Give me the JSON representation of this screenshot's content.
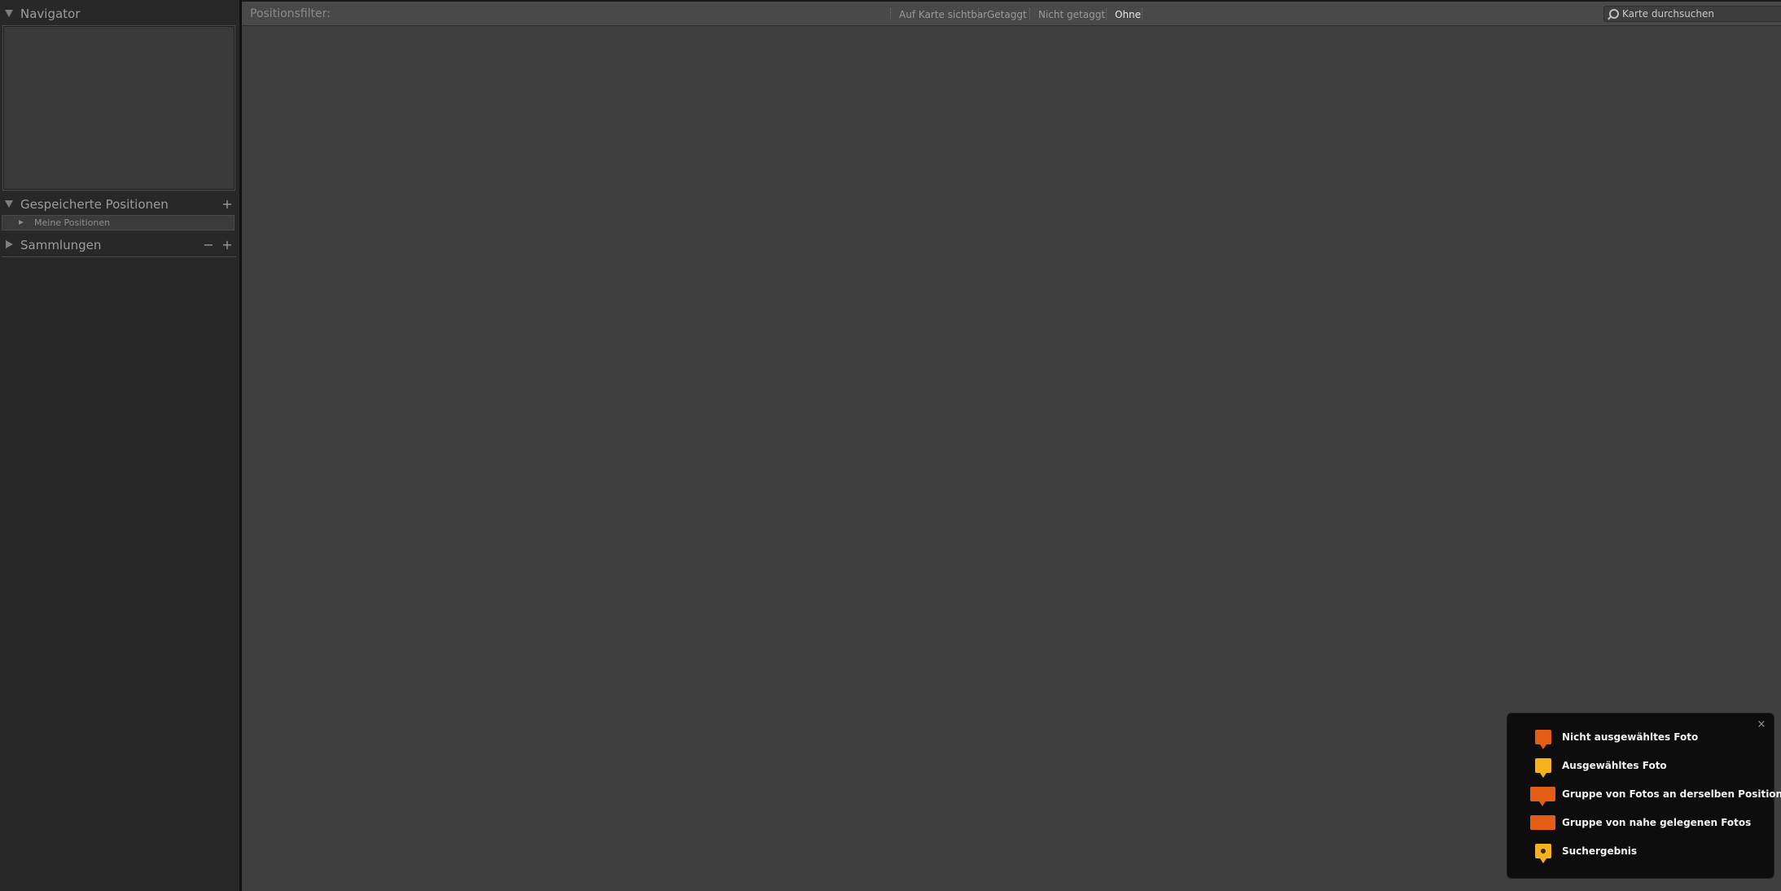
{
  "left_panel": {
    "navigator": {
      "title": "Navigator"
    },
    "saved_positions": {
      "title": "Gespeicherte Positionen",
      "add_label": "+",
      "items": [
        {
          "label": "Meine Positionen"
        }
      ]
    },
    "collections": {
      "title": "Sammlungen",
      "remove_label": "−",
      "add_label": "+"
    }
  },
  "filter_bar": {
    "label": "Positionsfilter:",
    "options": [
      {
        "label": "Auf Karte sichtbar",
        "active": false
      },
      {
        "label": "Getaggt",
        "active": false
      },
      {
        "label": "Nicht getaggt",
        "active": false
      },
      {
        "label": "Ohne",
        "active": true
      }
    ],
    "search": {
      "placeholder": "Karte durchsuchen",
      "value": ""
    }
  },
  "legend": {
    "close_label": "×",
    "items": [
      {
        "label": "Nicht ausgewähltes Foto",
        "icon": "unselected-photo-marker-icon",
        "color": "#e35d14"
      },
      {
        "label": "Ausgewähltes Foto",
        "icon": "selected-photo-marker-icon",
        "color": "#f5b21a"
      },
      {
        "label": "Gruppe von Fotos an derselben Position",
        "icon": "same-position-group-marker-icon",
        "color": "#e35d14"
      },
      {
        "label": "Gruppe von nahe gelegenen Fotos",
        "icon": "nearby-group-marker-icon",
        "color": "#e35d14"
      },
      {
        "label": "Suchergebnis",
        "icon": "search-result-marker-icon",
        "color": "#f5b21a"
      }
    ]
  },
  "colors": {
    "panel_bg": "#282828",
    "map_bg": "#3f3f3f",
    "filter_bar_bg": "#494949",
    "legend_bg": "#0d0d0d",
    "marker_orange": "#e35d14",
    "marker_yellow": "#f5b21a"
  }
}
